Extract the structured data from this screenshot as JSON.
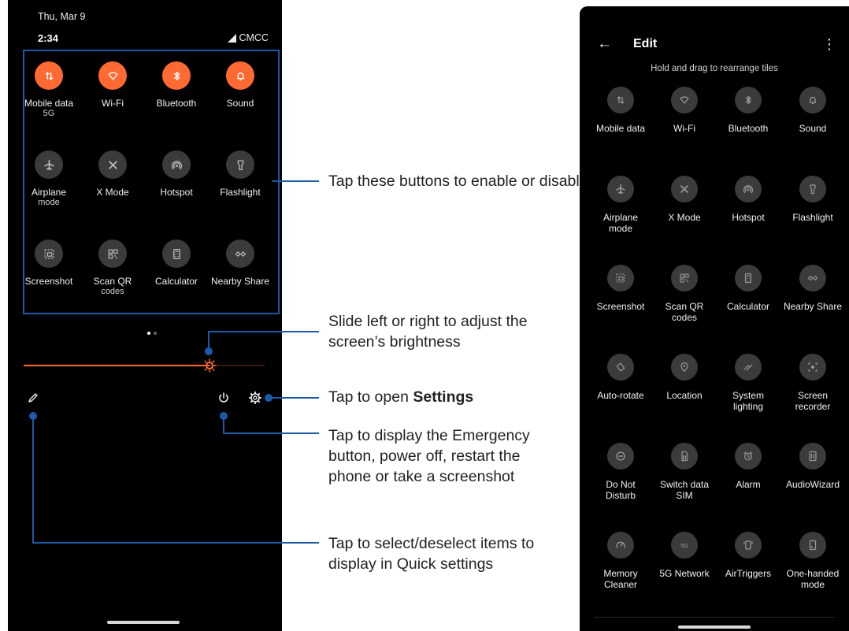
{
  "status": {
    "date": "Thu, Mar 9",
    "time": "2:34",
    "carrier": "CMCC"
  },
  "quick_settings": {
    "tiles": [
      {
        "label": "Mobile data",
        "sub": "5G",
        "icon": "mobile-data-icon",
        "state": "on"
      },
      {
        "label": "Wi-Fi",
        "sub": "",
        "icon": "wifi-icon",
        "state": "on"
      },
      {
        "label": "Bluetooth",
        "sub": "",
        "icon": "bluetooth-icon",
        "state": "on"
      },
      {
        "label": "Sound",
        "sub": "",
        "icon": "bell-icon",
        "state": "on"
      },
      {
        "label": "Airplane",
        "sub": "mode",
        "icon": "airplane-icon",
        "state": "off"
      },
      {
        "label": "X Mode",
        "sub": "",
        "icon": "x-mode-icon",
        "state": "off"
      },
      {
        "label": "Hotspot",
        "sub": "",
        "icon": "hotspot-icon",
        "state": "off"
      },
      {
        "label": "Flashlight",
        "sub": "",
        "icon": "flashlight-icon",
        "state": "off"
      },
      {
        "label": "Screenshot",
        "sub": "",
        "icon": "screenshot-icon",
        "state": "off"
      },
      {
        "label": "Scan QR",
        "sub": "codes",
        "icon": "qr-icon",
        "state": "off"
      },
      {
        "label": "Calculator",
        "sub": "",
        "icon": "calculator-icon",
        "state": "off"
      },
      {
        "label": "Nearby Share",
        "sub": "",
        "icon": "nearby-share-icon",
        "state": "off"
      }
    ],
    "brightness_level": 0.77
  },
  "callouts": {
    "tiles": "Tap these buttons to enable or disable their functions",
    "brightness": "Slide left or right to adjust the screen’s brightness",
    "settings_prefix": "Tap to open ",
    "settings_bold": "Settings",
    "power": "Tap to display the Emergency button, power off, restart the phone or take a screenshot",
    "edit": "Tap to select/deselect items to display in Quick settings"
  },
  "edit_screen": {
    "title": "Edit",
    "hint": "Hold and drag to rearrange tiles",
    "tiles": [
      {
        "label": "Mobile data",
        "sub": "",
        "icon": "mobile-data-icon"
      },
      {
        "label": "Wi-Fi",
        "sub": "",
        "icon": "wifi-icon"
      },
      {
        "label": "Bluetooth",
        "sub": "",
        "icon": "bluetooth-icon"
      },
      {
        "label": "Sound",
        "sub": "",
        "icon": "bell-icon"
      },
      {
        "label": "Airplane",
        "sub": "mode",
        "icon": "airplane-icon"
      },
      {
        "label": "X Mode",
        "sub": "",
        "icon": "x-mode-icon"
      },
      {
        "label": "Hotspot",
        "sub": "",
        "icon": "hotspot-icon"
      },
      {
        "label": "Flashlight",
        "sub": "",
        "icon": "flashlight-icon"
      },
      {
        "label": "Screenshot",
        "sub": "",
        "icon": "screenshot-icon"
      },
      {
        "label": "Scan QR",
        "sub": "codes",
        "icon": "qr-icon"
      },
      {
        "label": "Calculator",
        "sub": "",
        "icon": "calculator-icon"
      },
      {
        "label": "Nearby Share",
        "sub": "",
        "icon": "nearby-share-icon"
      },
      {
        "label": "Auto-rotate",
        "sub": "",
        "icon": "auto-rotate-icon"
      },
      {
        "label": "Location",
        "sub": "",
        "icon": "location-icon"
      },
      {
        "label": "System",
        "sub": "lighting",
        "icon": "system-lighting-icon"
      },
      {
        "label": "Screen",
        "sub": "recorder",
        "icon": "screen-recorder-icon"
      },
      {
        "label": "Do Not",
        "sub": "Disturb",
        "icon": "do-not-disturb-icon"
      },
      {
        "label": "Switch data",
        "sub": "SIM",
        "icon": "sim-icon"
      },
      {
        "label": "Alarm",
        "sub": "",
        "icon": "alarm-icon"
      },
      {
        "label": "AudioWizard",
        "sub": "",
        "icon": "audiowizard-icon"
      },
      {
        "label": "Memory",
        "sub": "Cleaner",
        "icon": "memory-cleaner-icon"
      },
      {
        "label": "5G Network",
        "sub": "",
        "icon": "5g-network-icon"
      },
      {
        "label": "AirTriggers",
        "sub": "",
        "icon": "airtriggers-icon"
      },
      {
        "label": "One-handed",
        "sub": "mode",
        "icon": "one-handed-icon"
      }
    ]
  },
  "colors": {
    "accent": "#ff6a33",
    "callout": "#1a5aa8",
    "tile_off": "#3b3b3b"
  }
}
